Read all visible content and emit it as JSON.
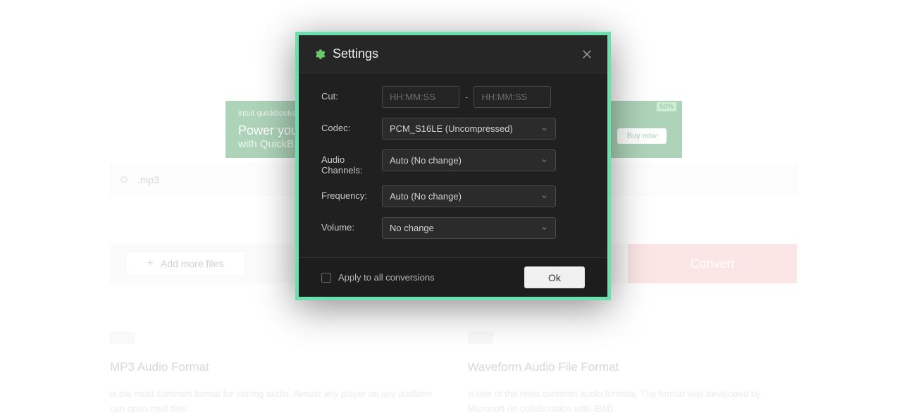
{
  "background": {
    "ad": {
      "brand": "intuit quickbooks",
      "headline": "Power you",
      "subline": "with QuickB",
      "cta": "Buy now",
      "tag": "50%"
    },
    "file_row": {
      "name": ".mp3"
    },
    "actions": {
      "add_more": "Add more files",
      "convert": "Convert"
    },
    "cards": [
      {
        "title": "MP3 Audio Format",
        "desc": "is the most common format for storing audio. Almost any player on any platform can open mp3 files."
      },
      {
        "title": "Waveform Audio File Format",
        "desc": "is one of the most common audio formats. The format was developed by Microsoft (in collaboration with IBM)."
      }
    ]
  },
  "modal": {
    "title": "Settings",
    "fields": {
      "cut": {
        "label": "Cut:",
        "from_placeholder": "HH:MM:SS",
        "to_placeholder": "HH:MM:SS",
        "separator": "-"
      },
      "codec": {
        "label": "Codec:",
        "value": "PCM_S16LE (Uncompressed)"
      },
      "channels": {
        "label": "Audio Channels:",
        "value": "Auto (No change)"
      },
      "frequency": {
        "label": "Frequency:",
        "value": "Auto (No change)"
      },
      "volume": {
        "label": "Volume:",
        "value": "No change"
      }
    },
    "footer": {
      "apply_all_label": "Apply to all conversions",
      "ok_label": "Ok"
    }
  }
}
